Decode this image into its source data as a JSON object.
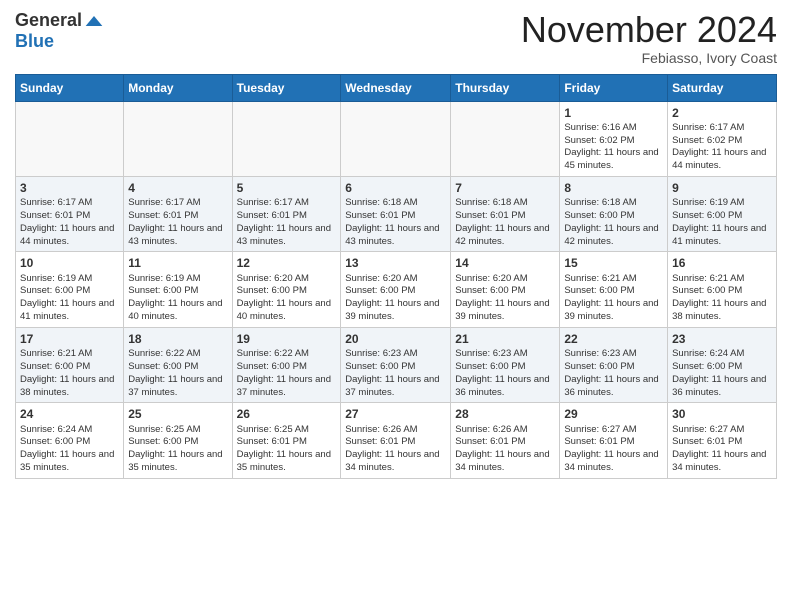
{
  "logo": {
    "general": "General",
    "blue": "Blue"
  },
  "title": "November 2024",
  "subtitle": "Febiasso, Ivory Coast",
  "weekdays": [
    "Sunday",
    "Monday",
    "Tuesday",
    "Wednesday",
    "Thursday",
    "Friday",
    "Saturday"
  ],
  "weeks": [
    [
      {
        "day": "",
        "info": ""
      },
      {
        "day": "",
        "info": ""
      },
      {
        "day": "",
        "info": ""
      },
      {
        "day": "",
        "info": ""
      },
      {
        "day": "",
        "info": ""
      },
      {
        "day": "1",
        "info": "Sunrise: 6:16 AM\nSunset: 6:02 PM\nDaylight: 11 hours and 45 minutes."
      },
      {
        "day": "2",
        "info": "Sunrise: 6:17 AM\nSunset: 6:02 PM\nDaylight: 11 hours and 44 minutes."
      }
    ],
    [
      {
        "day": "3",
        "info": "Sunrise: 6:17 AM\nSunset: 6:01 PM\nDaylight: 11 hours and 44 minutes."
      },
      {
        "day": "4",
        "info": "Sunrise: 6:17 AM\nSunset: 6:01 PM\nDaylight: 11 hours and 43 minutes."
      },
      {
        "day": "5",
        "info": "Sunrise: 6:17 AM\nSunset: 6:01 PM\nDaylight: 11 hours and 43 minutes."
      },
      {
        "day": "6",
        "info": "Sunrise: 6:18 AM\nSunset: 6:01 PM\nDaylight: 11 hours and 43 minutes."
      },
      {
        "day": "7",
        "info": "Sunrise: 6:18 AM\nSunset: 6:01 PM\nDaylight: 11 hours and 42 minutes."
      },
      {
        "day": "8",
        "info": "Sunrise: 6:18 AM\nSunset: 6:00 PM\nDaylight: 11 hours and 42 minutes."
      },
      {
        "day": "9",
        "info": "Sunrise: 6:19 AM\nSunset: 6:00 PM\nDaylight: 11 hours and 41 minutes."
      }
    ],
    [
      {
        "day": "10",
        "info": "Sunrise: 6:19 AM\nSunset: 6:00 PM\nDaylight: 11 hours and 41 minutes."
      },
      {
        "day": "11",
        "info": "Sunrise: 6:19 AM\nSunset: 6:00 PM\nDaylight: 11 hours and 40 minutes."
      },
      {
        "day": "12",
        "info": "Sunrise: 6:20 AM\nSunset: 6:00 PM\nDaylight: 11 hours and 40 minutes."
      },
      {
        "day": "13",
        "info": "Sunrise: 6:20 AM\nSunset: 6:00 PM\nDaylight: 11 hours and 39 minutes."
      },
      {
        "day": "14",
        "info": "Sunrise: 6:20 AM\nSunset: 6:00 PM\nDaylight: 11 hours and 39 minutes."
      },
      {
        "day": "15",
        "info": "Sunrise: 6:21 AM\nSunset: 6:00 PM\nDaylight: 11 hours and 39 minutes."
      },
      {
        "day": "16",
        "info": "Sunrise: 6:21 AM\nSunset: 6:00 PM\nDaylight: 11 hours and 38 minutes."
      }
    ],
    [
      {
        "day": "17",
        "info": "Sunrise: 6:21 AM\nSunset: 6:00 PM\nDaylight: 11 hours and 38 minutes."
      },
      {
        "day": "18",
        "info": "Sunrise: 6:22 AM\nSunset: 6:00 PM\nDaylight: 11 hours and 37 minutes."
      },
      {
        "day": "19",
        "info": "Sunrise: 6:22 AM\nSunset: 6:00 PM\nDaylight: 11 hours and 37 minutes."
      },
      {
        "day": "20",
        "info": "Sunrise: 6:23 AM\nSunset: 6:00 PM\nDaylight: 11 hours and 37 minutes."
      },
      {
        "day": "21",
        "info": "Sunrise: 6:23 AM\nSunset: 6:00 PM\nDaylight: 11 hours and 36 minutes."
      },
      {
        "day": "22",
        "info": "Sunrise: 6:23 AM\nSunset: 6:00 PM\nDaylight: 11 hours and 36 minutes."
      },
      {
        "day": "23",
        "info": "Sunrise: 6:24 AM\nSunset: 6:00 PM\nDaylight: 11 hours and 36 minutes."
      }
    ],
    [
      {
        "day": "24",
        "info": "Sunrise: 6:24 AM\nSunset: 6:00 PM\nDaylight: 11 hours and 35 minutes."
      },
      {
        "day": "25",
        "info": "Sunrise: 6:25 AM\nSunset: 6:00 PM\nDaylight: 11 hours and 35 minutes."
      },
      {
        "day": "26",
        "info": "Sunrise: 6:25 AM\nSunset: 6:01 PM\nDaylight: 11 hours and 35 minutes."
      },
      {
        "day": "27",
        "info": "Sunrise: 6:26 AM\nSunset: 6:01 PM\nDaylight: 11 hours and 34 minutes."
      },
      {
        "day": "28",
        "info": "Sunrise: 6:26 AM\nSunset: 6:01 PM\nDaylight: 11 hours and 34 minutes."
      },
      {
        "day": "29",
        "info": "Sunrise: 6:27 AM\nSunset: 6:01 PM\nDaylight: 11 hours and 34 minutes."
      },
      {
        "day": "30",
        "info": "Sunrise: 6:27 AM\nSunset: 6:01 PM\nDaylight: 11 hours and 34 minutes."
      }
    ]
  ]
}
